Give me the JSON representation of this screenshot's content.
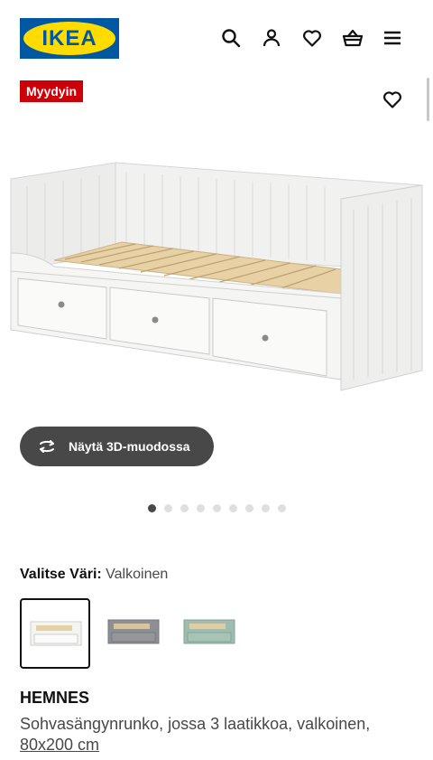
{
  "header": {
    "logo_text": "IKEA",
    "icons": [
      "search-icon",
      "user-icon",
      "heart-icon",
      "basket-icon",
      "menu-icon"
    ]
  },
  "badge": {
    "label": "Myydyin"
  },
  "gallery": {
    "view3d_label": "Näytä 3D-muodossa",
    "image_count": 9,
    "active_index": 0
  },
  "color": {
    "label": "Valitse Väri:",
    "value": "Valkoinen",
    "options": [
      {
        "color": "#f4f4f2",
        "selected": true
      },
      {
        "color": "#8d8f93",
        "selected": false
      },
      {
        "color": "#9fbcae",
        "selected": false
      }
    ]
  },
  "product": {
    "name": "HEMNES",
    "description": "Sohvasängynrunko, jossa 3 laatikkoa, valkoinen,",
    "size": "80x200 cm"
  },
  "colors": {
    "brand_blue": "#0058a3",
    "brand_yellow": "#ffdb00",
    "badge_red": "#cc0008",
    "button_dark": "#484848"
  }
}
